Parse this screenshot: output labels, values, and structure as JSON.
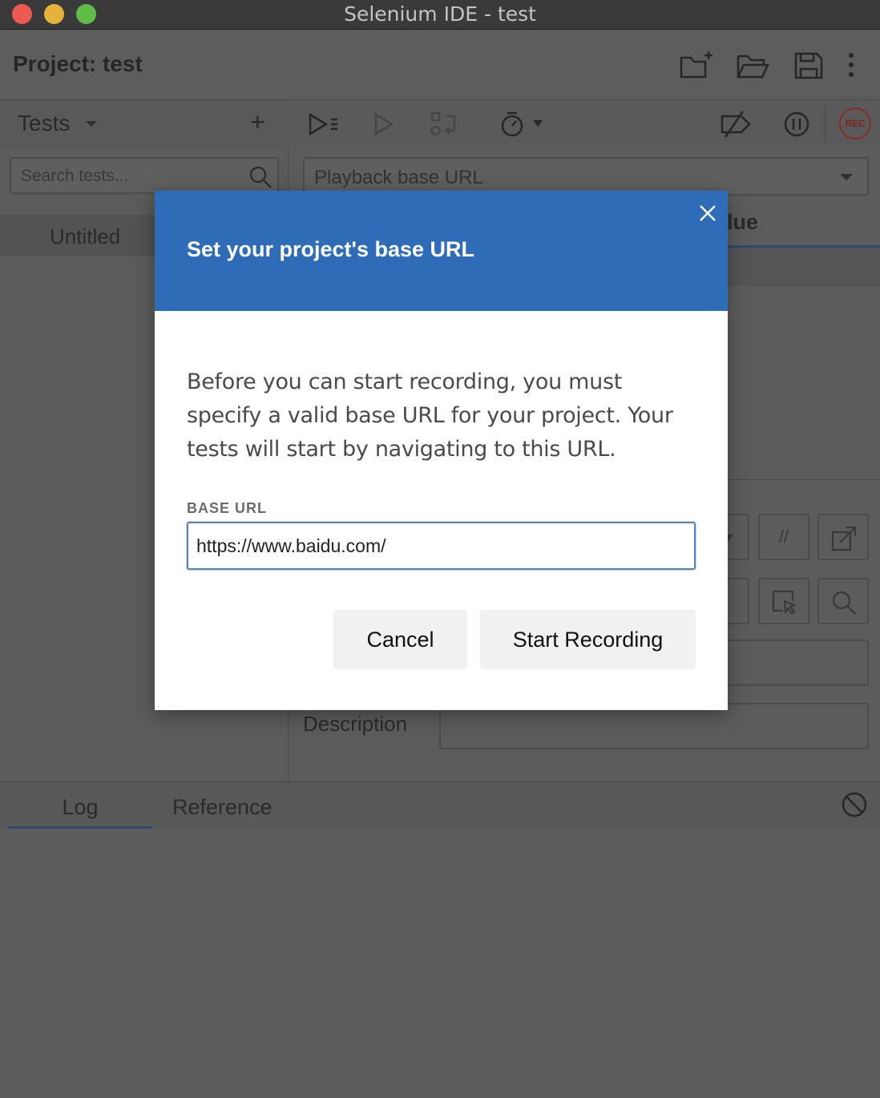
{
  "window": {
    "title": "Selenium IDE - test"
  },
  "project": {
    "label": "Project:  test"
  },
  "tests_panel": {
    "title": "Tests",
    "add_symbol": "+",
    "search_placeholder": "Search tests...",
    "items": [
      {
        "label": "Untitled"
      }
    ]
  },
  "editor": {
    "base_url_placeholder": "Playback base URL",
    "value_column_header": "lue",
    "comment_symbol": "//",
    "description_label": "Description",
    "rec_label": "REC"
  },
  "bottom_panel": {
    "tabs": [
      "Log",
      "Reference"
    ],
    "active_tab": "Log"
  },
  "modal": {
    "title": "Set your project's base URL",
    "body": "Before you can start recording, you must specify a valid base URL for your project. Your tests will start by navigating to this URL.",
    "field_label": "BASE URL",
    "field_value": "https://www.baidu.com/",
    "cancel_label": "Cancel",
    "start_label": "Start Recording"
  },
  "colors": {
    "modal_header": "#2f6cb8",
    "overlay_background": "#5c5c5c",
    "rec_red": "#8a2b26",
    "input_focus_border": "#5b7fba"
  },
  "icons": [
    "new-project-icon",
    "open-project-icon",
    "save-icon",
    "more-vert-icon",
    "run-all-icon",
    "run-current-icon",
    "step-icon",
    "speed-icon",
    "disable-breakpoints-icon",
    "pause-icon",
    "record-icon",
    "search-icon",
    "clear-log-icon",
    "close-icon"
  ]
}
